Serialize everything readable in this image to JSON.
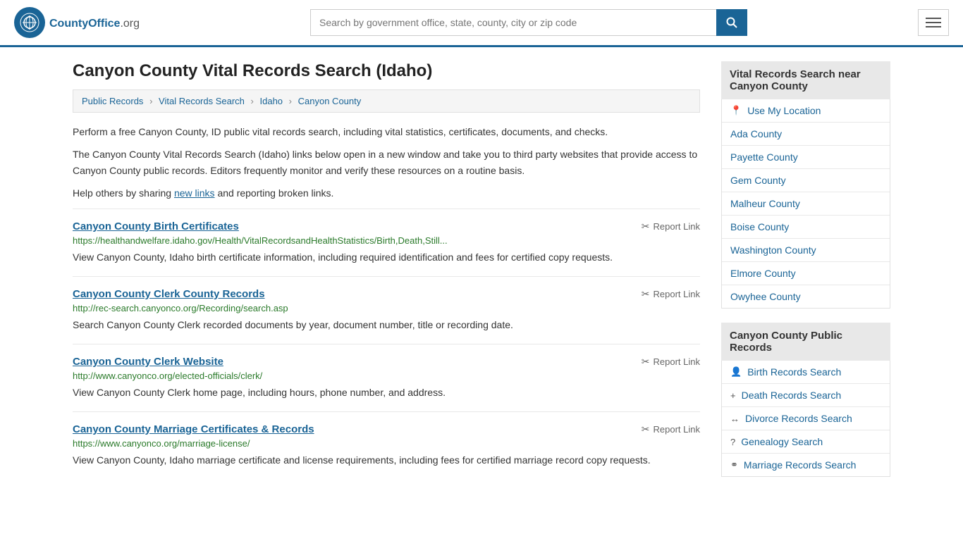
{
  "header": {
    "logo_text": "CountyOffice",
    "logo_tld": ".org",
    "search_placeholder": "Search by government office, state, county, city or zip code"
  },
  "page": {
    "title": "Canyon County Vital Records Search (Idaho)",
    "breadcrumb": [
      {
        "label": "Public Records",
        "href": "#"
      },
      {
        "label": "Vital Records Search",
        "href": "#"
      },
      {
        "label": "Idaho",
        "href": "#"
      },
      {
        "label": "Canyon County",
        "href": "#"
      }
    ],
    "description1": "Perform a free Canyon County, ID public vital records search, including vital statistics, certificates, documents, and checks.",
    "description2": "The Canyon County Vital Records Search (Idaho) links below open in a new window and take you to third party websites that provide access to Canyon County public records. Editors frequently monitor and verify these resources on a routine basis.",
    "description3_pre": "Help others by sharing ",
    "description3_link": "new links",
    "description3_post": " and reporting broken links."
  },
  "results": [
    {
      "title": "Canyon County Birth Certificates",
      "url": "https://healthandwelfare.idaho.gov/Health/VitalRecordsandHealthStatistics/Birth,Death,Still...",
      "description": "View Canyon County, Idaho birth certificate information, including required identification and fees for certified copy requests.",
      "report_label": "Report Link"
    },
    {
      "title": "Canyon County Clerk County Records",
      "url": "http://rec-search.canyonco.org/Recording/search.asp",
      "description": "Search Canyon County Clerk recorded documents by year, document number, title or recording date.",
      "report_label": "Report Link"
    },
    {
      "title": "Canyon County Clerk Website",
      "url": "http://www.canyonco.org/elected-officials/clerk/",
      "description": "View Canyon County Clerk home page, including hours, phone number, and address.",
      "report_label": "Report Link"
    },
    {
      "title": "Canyon County Marriage Certificates & Records",
      "url": "https://www.canyonco.org/marriage-license/",
      "description": "View Canyon County, Idaho marriage certificate and license requirements, including fees for certified marriage record copy requests.",
      "report_label": "Report Link"
    }
  ],
  "sidebar": {
    "nearby_title": "Vital Records Search near Canyon County",
    "location_item": "Use My Location",
    "nearby_counties": [
      "Ada County",
      "Payette County",
      "Gem County",
      "Malheur County",
      "Boise County",
      "Washington County",
      "Elmore County",
      "Owyhee County"
    ],
    "public_records_title": "Canyon County Public Records",
    "public_records_items": [
      {
        "icon": "👤",
        "label": "Birth Records Search"
      },
      {
        "icon": "+",
        "label": "Death Records Search"
      },
      {
        "icon": "↔",
        "label": "Divorce Records Search"
      },
      {
        "icon": "?",
        "label": "Genealogy Search"
      },
      {
        "icon": "⚭",
        "label": "Marriage Records Search"
      }
    ]
  }
}
